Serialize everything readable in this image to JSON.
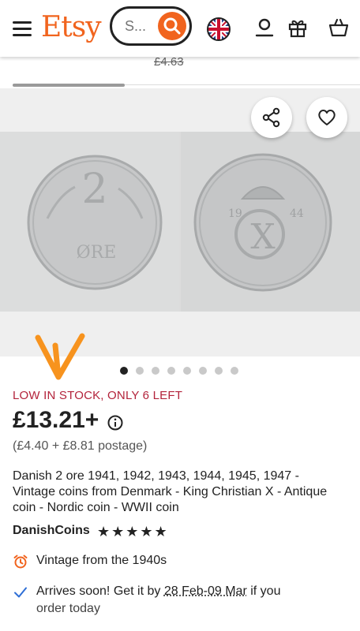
{
  "header": {
    "logo": "Etsy",
    "search_placeholder": "S...",
    "icons": [
      "menu-icon",
      "search-icon",
      "uk-flag-icon",
      "account-icon",
      "gift-icon",
      "basket-icon"
    ]
  },
  "strip": {
    "old_price": "£4.63"
  },
  "gallery": {
    "image_count": 8,
    "active_index": 0
  },
  "product": {
    "stock_text": "LOW IN STOCK, ONLY 6 LEFT",
    "price": "£13.21+",
    "price_breakdown": "(£4.40 + £8.81 postage)",
    "title": "Danish 2 ore 1941, 1942, 1943, 1944, 1945, 1947 - Vintage coins from Denmark - King Christian X - Antique coin - Nordic coin - WWII coin",
    "shop_name": "DanishCoins",
    "rating_stars": "★★★★★",
    "vintage_text": "Vintage from the 1940s",
    "arrives_prefix": "Arrives soon! Get it by ",
    "arrives_dates": "28 Feb-09 Mar",
    "arrives_suffix": " if you",
    "arrives_line2": "order today"
  },
  "colors": {
    "brand": "#f1641e",
    "stock": "#b3233b",
    "check": "#2f6fd6"
  }
}
